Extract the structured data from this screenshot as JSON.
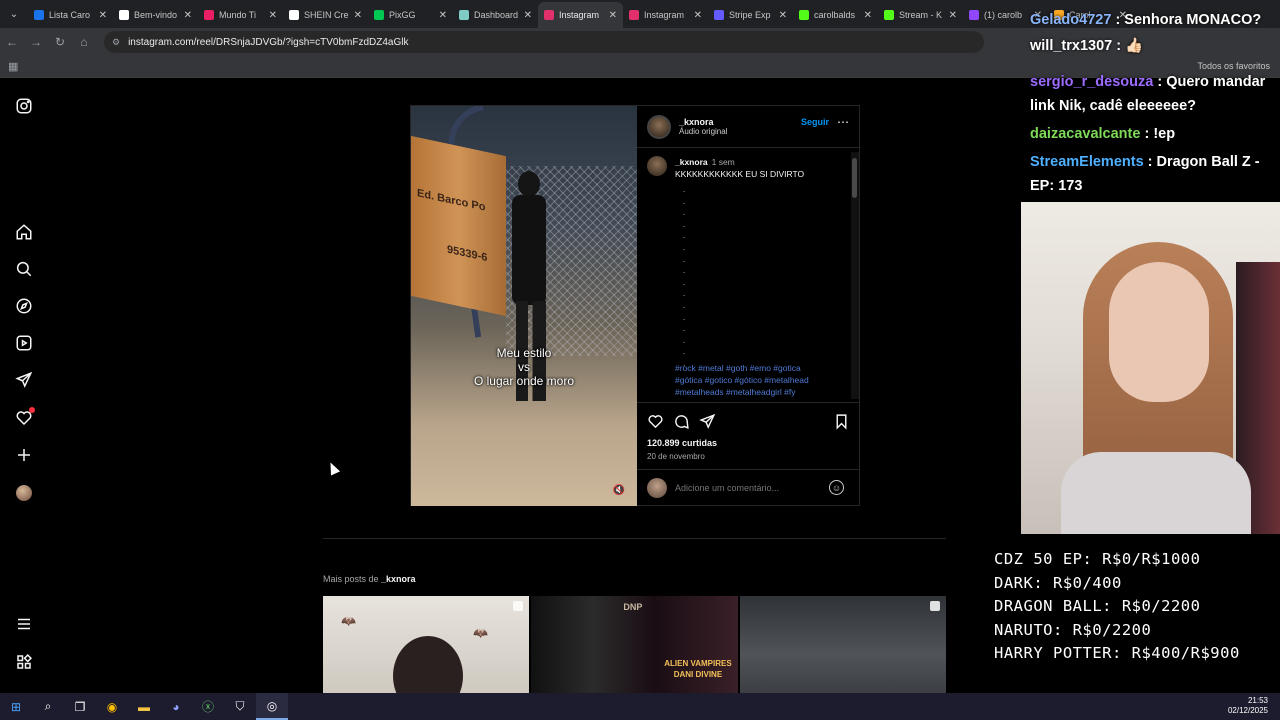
{
  "browser": {
    "tabs": [
      {
        "label": "Lista Caro",
        "color": "#1a73e8"
      },
      {
        "label": "Bem-vindo",
        "color": "#ffffff"
      },
      {
        "label": "Mundo Ti",
        "color": "#e91e63"
      },
      {
        "label": "SHEIN Cre",
        "color": "#ffffff"
      },
      {
        "label": "PixGG",
        "color": "#00c853"
      },
      {
        "label": "Dashboard",
        "color": "#80cbc4"
      },
      {
        "label": "Instagram",
        "color": "#e1306c",
        "active": true
      },
      {
        "label": "Instagram",
        "color": "#e1306c"
      },
      {
        "label": "Stripe Exp",
        "color": "#635bff"
      },
      {
        "label": "carolbalds",
        "color": "#53fc18"
      },
      {
        "label": "Stream - K",
        "color": "#53fc18"
      },
      {
        "label": "(1) carolb",
        "color": "#9146ff"
      },
      {
        "label": "Carol",
        "color": "#f9a825"
      }
    ],
    "url": "instagram.com/reel/DRSnjaJDVGb/?igsh=cTV0bmFzdDZ4aGlk",
    "favorites_label": "Todos os favoritos"
  },
  "post": {
    "username": "_kxnora",
    "audio": "Áudio original",
    "follow": "Seguir",
    "overlay_text_1": "Meu estilo",
    "overlay_text_2": "vs",
    "overlay_text_3": "O lugar onde moro",
    "wall_text_1": "Ed. Barco Po",
    "wall_text_2": "95339-6",
    "caption_user": "_kxnora",
    "caption_time": "1 sem",
    "caption_text": "KKKKKKKKKKKK EU SI DIVIRTO",
    "caption_dots": ".\n.\n.\n.\n.\n.\n.\n.\n.\n.\n.\n.\n.\n.\n.\n.",
    "hashtags_1": "#rock #metal #goth #emo #gotica",
    "hashtags_2": "#gótica #gotico #gótico #metalhead",
    "hashtags_3": "#metalheads #metalheadgirl #fy",
    "likes": "120.899 curtidas",
    "date": "20 de novembro",
    "comment_placeholder": "Adicione um comentário..."
  },
  "more_posts": {
    "prefix": "Mais posts de ",
    "user": "_kxnora",
    "thumb2_logo": "DNP",
    "thumb2_text": "ALIEN VAMPIRES\nDANI DIVINE"
  },
  "stream": {
    "chat": [
      {
        "user": "Gelado4727",
        "user_color": "#8ab4f8",
        "msg": " : Senhora MONACO?"
      },
      {
        "user": "will_trx1307",
        "user_color": "#ffffff",
        "msg": " : 👍🏻"
      },
      {
        "user": "sergio_r_desouza",
        "user_color": "#9c6cff",
        "msg": " : Quero mandar link Nik, cadê eleeeeee?"
      },
      {
        "user": "daizacavalcante",
        "user_color": "#7ed957",
        "msg": " : !ep"
      },
      {
        "user": "StreamElements",
        "user_color": "#4fb0ff",
        "msg": " : Dragon Ball Z - EP: 173"
      }
    ],
    "goals": [
      "CDZ 50 EP: R$0/R$1000",
      "DARK: R$0/400",
      "DRAGON BALL: R$0/2200",
      "NARUTO: R$0/2200",
      "HARRY POTTER: R$400/R$900"
    ]
  },
  "taskbar": {
    "time": "21:53",
    "date": "02/12/2025"
  }
}
